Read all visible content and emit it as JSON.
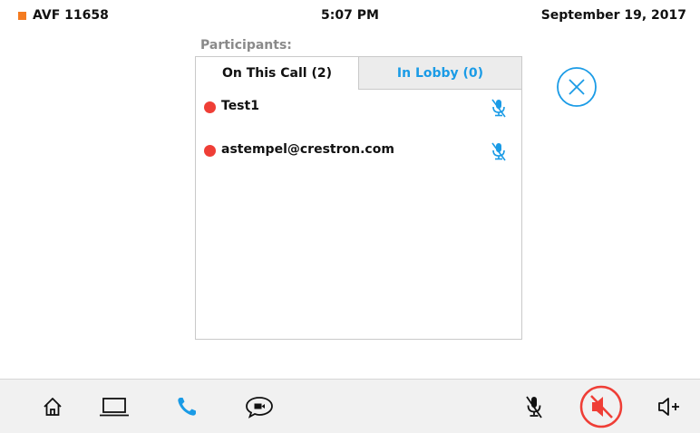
{
  "status": {
    "room_name": "AVF 11658",
    "time": "5:07 PM",
    "date": "September 19, 2017"
  },
  "participants_heading": "Participants:",
  "tabs": [
    {
      "label": "On This Call (2)",
      "active": true
    },
    {
      "label": "In Lobby (0)",
      "active": false
    }
  ],
  "participants": [
    {
      "name": "Test1",
      "status_color": "#ef3e36",
      "mic_icon": "mic-muted-icon"
    },
    {
      "name": "astempel@crestron.com",
      "status_color": "#ef3e36",
      "mic_icon": "mic-muted-icon"
    }
  ],
  "close_icon": "close-circle-icon",
  "bottom_bar": {
    "left_icons": [
      "home-icon",
      "laptop-icon",
      "phone-icon",
      "chat-video-icon"
    ],
    "right_icons": [
      "mic-muted-icon",
      "speaker-muted-icon",
      "volume-up-icon"
    ]
  },
  "colors": {
    "accent": "#1a9be6",
    "alert": "#ef3e36",
    "room_indicator": "#f47b20"
  }
}
